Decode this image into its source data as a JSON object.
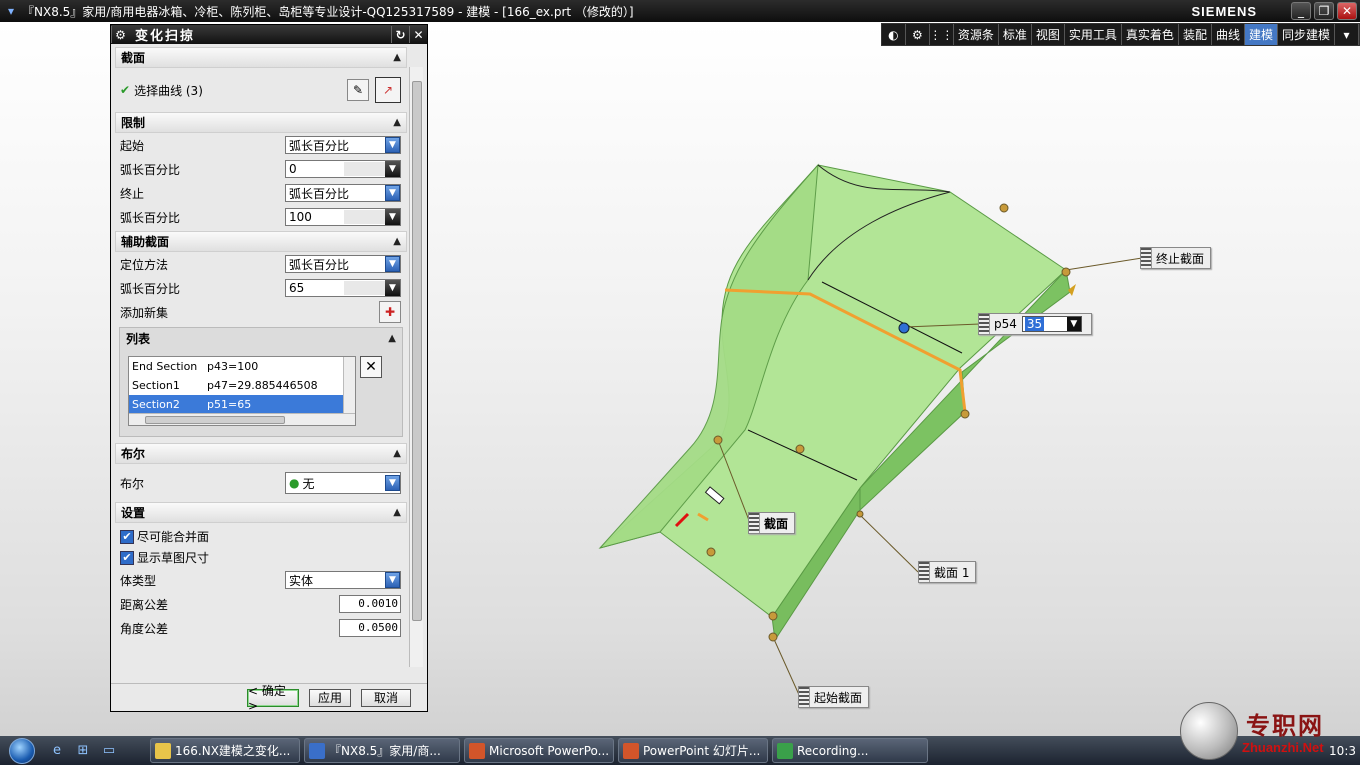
{
  "window": {
    "title": "『NX8.5』家用/商用电器冰箱、冷柜、陈列柜、岛柜等专业设计-QQ125317589 - 建模 - [166_ex.prt （修改的）]",
    "brand": "SIEMENS",
    "minimize": "_",
    "restore": "❐",
    "close": "✕"
  },
  "toolbar": {
    "items": [
      "资源条",
      "标准",
      "视图",
      "实用工具",
      "真实着色",
      "装配",
      "曲线",
      "建模",
      "同步建模"
    ],
    "active": "建模"
  },
  "dialog": {
    "title": "变化扫掠",
    "section_panel": {
      "header": "截面",
      "select_label": "选择曲线 (3)"
    },
    "limits": {
      "header": "限制",
      "start_label": "起始",
      "start_value": "弧长百分比",
      "start_pct_label": "弧长百分比",
      "start_pct_value": "0",
      "end_label": "终止",
      "end_value": "弧长百分比",
      "end_pct_label": "弧长百分比",
      "end_pct_value": "100"
    },
    "aux": {
      "header": "辅助截面",
      "method_label": "定位方法",
      "method_value": "弧长百分比",
      "pct_label": "弧长百分比",
      "pct_value": "65",
      "add_label": "添加新集",
      "list_header": "列表",
      "list": [
        {
          "name": "End Section",
          "value": "p43=100"
        },
        {
          "name": "Section1",
          "value": "p47=29.885446508"
        },
        {
          "name": "Section2",
          "value": "p51=65"
        }
      ]
    },
    "boolean": {
      "header": "布尔",
      "label": "布尔",
      "value": "无"
    },
    "settings": {
      "header": "设置",
      "merge_label": "尽可能合并面",
      "sketch_dim_label": "显示草图尺寸",
      "body_type_label": "体类型",
      "body_type_value": "实体",
      "dist_tol_label": "距离公差",
      "dist_tol_value": "0.0010",
      "angle_tol_label": "角度公差",
      "angle_tol_value": "0.0500"
    },
    "buttons": {
      "ok": "< 确定 >",
      "apply": "应用",
      "cancel": "取消"
    }
  },
  "callouts": {
    "end_section": "终止截面",
    "p54_label": "p54",
    "p54_value": "35",
    "section": "截面",
    "section1": "截面 1",
    "start_section": "起始截面"
  },
  "taskbar": {
    "tasks": [
      "166.NX建模之变化...",
      "『NX8.5』家用/商...",
      "Microsoft PowerPo...",
      "PowerPoint 幻灯片...",
      "Recording..."
    ],
    "clock": "10:3"
  },
  "watermark": {
    "cn": "专职网",
    "en": "Zhuanzhi.Net"
  },
  "colors": {
    "model_face": "#a8e08a",
    "model_side": "#7cc262",
    "highlight": "#f0a030",
    "title_bar": "#111111",
    "active_tab": "#4478c4"
  }
}
